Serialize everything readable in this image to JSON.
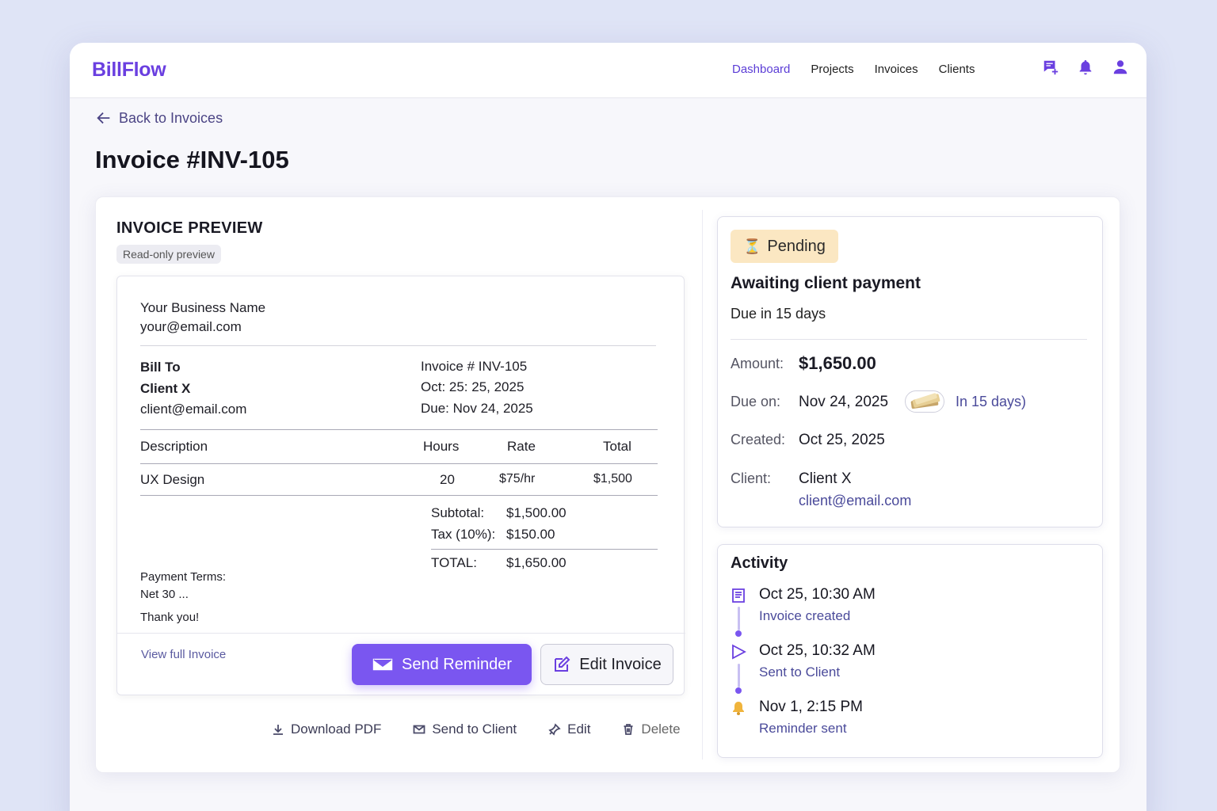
{
  "app": {
    "brand": "BillFlow"
  },
  "nav": {
    "items": [
      "Dashboard",
      "Projects",
      "Invoices",
      "Clients"
    ],
    "active": "Dashboard"
  },
  "back_label": "Back to Invoices",
  "page_title": "Invoice #INV-105",
  "preview": {
    "title": "INVOICE PREVIEW",
    "badge": "Read-only preview",
    "business_name": "Your Business Name",
    "business_email": "your@email.com",
    "bill_to_label": "Bill To",
    "client_name": "Client X",
    "client_email": "client@email.com",
    "invoice_no": "Invoice # INV-105",
    "invoice_date": "Oct: 25: 25, 2025",
    "invoice_due": "Due: Nov 24, 2025",
    "table": {
      "headers": [
        "Description",
        "Hours",
        "Rate",
        "Total"
      ],
      "rows": [
        [
          "UX Design",
          "20",
          "$75/hr",
          "$1,500"
        ]
      ]
    },
    "subtotal_label": "Subtotal:",
    "subtotal_value": "$1,500.00",
    "tax_label": "Tax (10%):",
    "tax_value": "$150.00",
    "total_label": "TOTAL:",
    "total_value": "$1,650.00",
    "terms_label": "Payment Terms:",
    "terms_value": "Net 30 ...",
    "thanks": "Thank you!",
    "view_full": "View full Invoice",
    "send_reminder": "Send Reminder",
    "edit_invoice": "Edit Invoice"
  },
  "actions": [
    "Download PDF",
    "Send to Client",
    "Edit",
    "Delete"
  ],
  "status": {
    "badge": "Pending",
    "badge_icon": "⏳",
    "title": "Awaiting client payment",
    "subtitle": "Due in 15 days",
    "amount_label": "Amount:",
    "amount_value": "$1,650.00",
    "due_label": "Due on:",
    "due_value": "Nov 24, 2025",
    "due_relative": "In 15 days)",
    "created_label": "Created:",
    "created_value": "Oct 25, 2025",
    "client_label": "Client:",
    "client_value": "Client X",
    "client_email": "client@email.com"
  },
  "activity": {
    "title": "Activity",
    "items": [
      {
        "time": "Oct 25, 10:30 AM",
        "desc": "Invoice created",
        "icon": "document-icon"
      },
      {
        "time": "Oct 25, 10:32 AM",
        "desc": "Sent to Client",
        "icon": "send-icon"
      },
      {
        "time": "Nov 1, 2:15 PM",
        "desc": "Reminder sent",
        "icon": "bell-icon"
      }
    ]
  },
  "colors": {
    "accent": "#7a56f0",
    "brand": "#6a3fe0",
    "pending_bg": "#fbe7c2",
    "link": "#4a4a9a"
  }
}
